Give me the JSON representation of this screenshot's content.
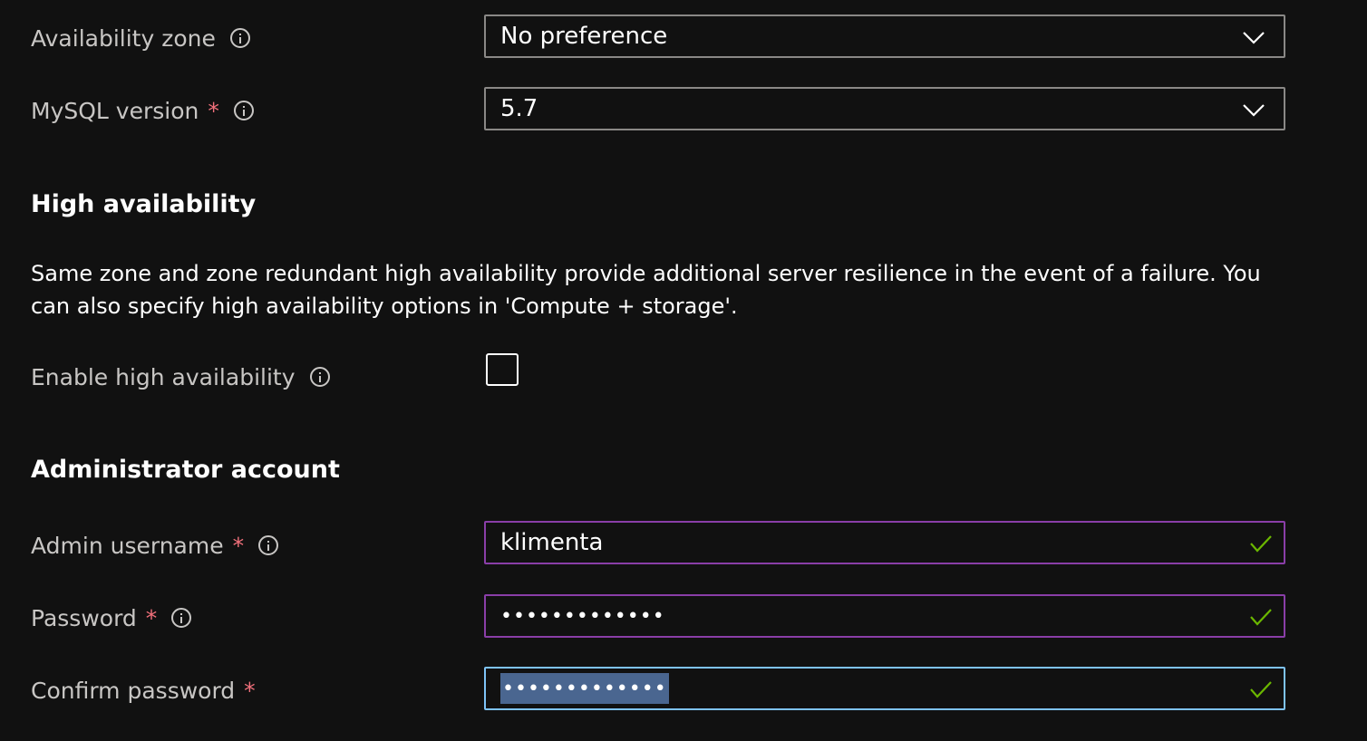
{
  "availability_zone": {
    "label": "Availability zone",
    "value": "No preference"
  },
  "mysql_version": {
    "label": "MySQL version",
    "required": "*",
    "value": "5.7"
  },
  "high_availability": {
    "heading": "High availability",
    "description": "Same zone and zone redundant high availability provide additional server resilience in the event of a failure. You can also specify high availability options in 'Compute + storage'.",
    "enable_label": "Enable high availability",
    "enabled": false
  },
  "admin_account": {
    "heading": "Administrator account",
    "username_label": "Admin username",
    "username_required": "*",
    "username_value": "klimenta",
    "password_label": "Password",
    "password_required": "*",
    "password_value": "•••••••••••••",
    "confirm_label": "Confirm password",
    "confirm_required": "*",
    "confirm_value": "•••••••••••••"
  },
  "colors": {
    "background": "#111111",
    "label": "#c8c6c4",
    "required": "#f1707b",
    "valid_border": "#8a3ea8",
    "focus_border": "#7ec3f7",
    "check": "#6bb700",
    "selection": "#4a6690"
  },
  "icons": [
    "info-icon",
    "chevron-down-icon",
    "checkmark-icon"
  ]
}
